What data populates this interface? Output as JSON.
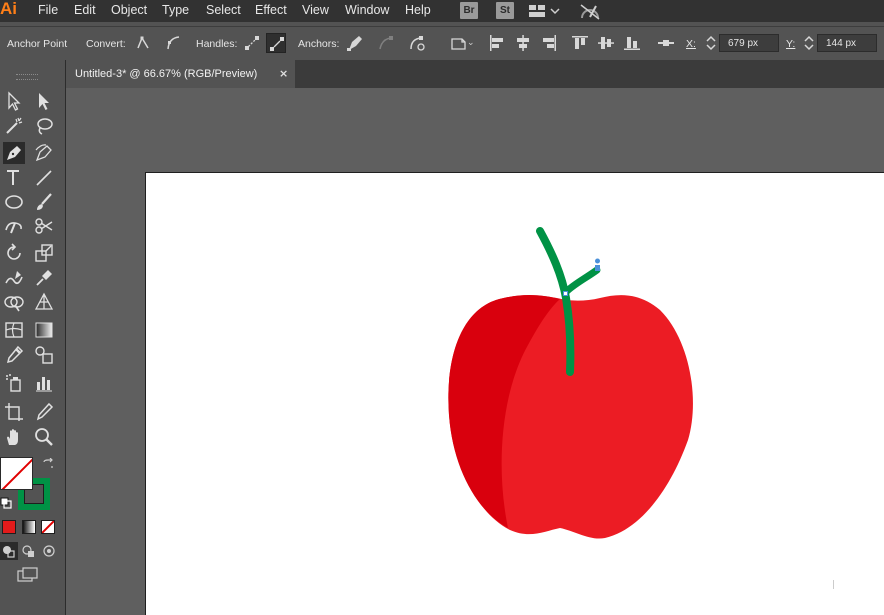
{
  "app": {
    "logo_text": "Ai"
  },
  "menubar": {
    "items": [
      "File",
      "Edit",
      "Object",
      "Type",
      "Select",
      "Effect",
      "View",
      "Window",
      "Help"
    ],
    "badges": [
      "Br",
      "St"
    ]
  },
  "control_bar": {
    "tool_name": "Anchor Point",
    "convert_label": "Convert:",
    "handles_label": "Handles:",
    "anchors_label": "Anchors:",
    "x_label": "X:",
    "x_value": "679 px",
    "y_label": "Y:",
    "y_value": "144 px"
  },
  "document": {
    "tab_title": "Untitled-3* @ 66.67% (RGB/Preview)",
    "close_glyph": "×"
  },
  "colors": {
    "apple_main": "#ec1c24",
    "apple_shadow": "#d9000d",
    "stem": "#009245",
    "anchor": "#4a90d9",
    "fill_swatch": "#ffffff",
    "stroke_swatch": "#009245",
    "logo": "#ff7f18"
  }
}
